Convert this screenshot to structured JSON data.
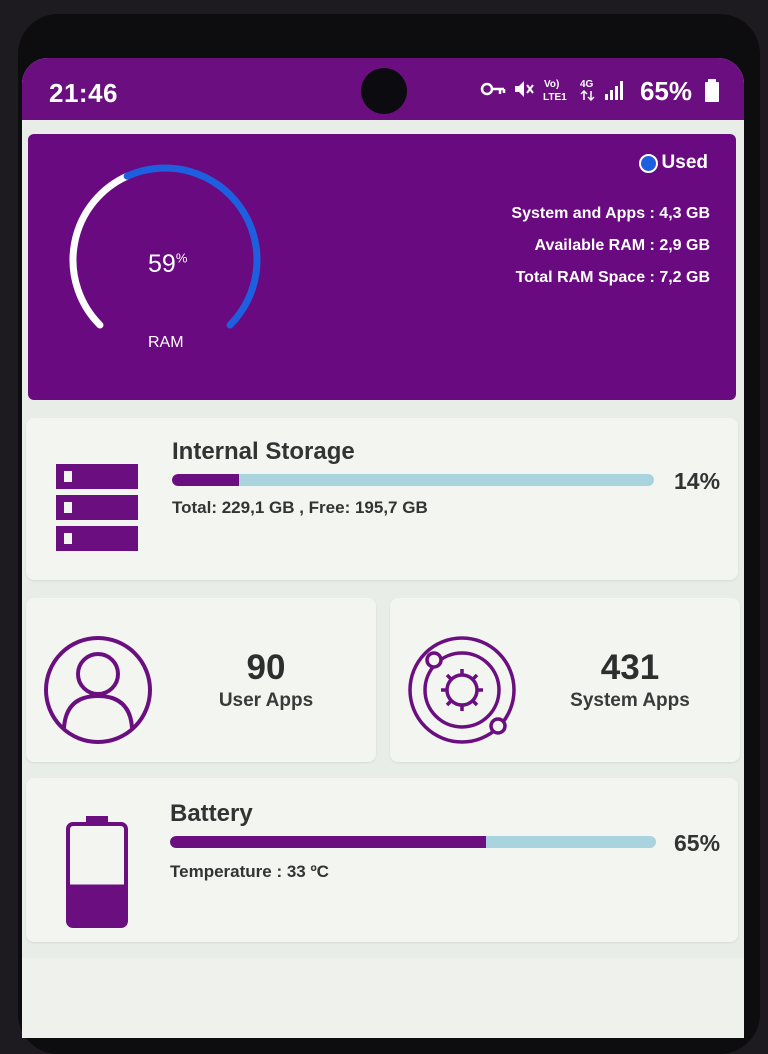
{
  "status_bar": {
    "time": "21:46",
    "icons": [
      "vpn-key-icon",
      "mute-icon",
      "volte-icon",
      "4g-icon",
      "signal-icon"
    ],
    "volte_top": "Vo)",
    "volte_bottom": "LTE1",
    "network": "4G",
    "battery_percent": "65%"
  },
  "ram": {
    "percent": "59",
    "percent_sign": "%",
    "percent_value": 0.59,
    "label": "RAM",
    "legend": "Used",
    "lines": [
      "System and Apps : 4,3 GB",
      "Available RAM : 2,9 GB",
      "Total RAM Space : 7,2 GB"
    ]
  },
  "storage": {
    "title": "Internal Storage",
    "percent": "14%",
    "percent_value": 0.14,
    "total": "Total:  229,1 GB ,  Free: 195,7 GB"
  },
  "user_apps": {
    "count": "90",
    "label": "User Apps"
  },
  "system_apps": {
    "count": "431",
    "label": "System Apps"
  },
  "battery": {
    "title": "Battery",
    "percent": "65%",
    "percent_value": 0.65,
    "temperature": "Temperature : 33 ºC"
  },
  "colors": {
    "accent": "#6b0f80",
    "used": "#1e5fe0",
    "track": "#a9d3df"
  }
}
